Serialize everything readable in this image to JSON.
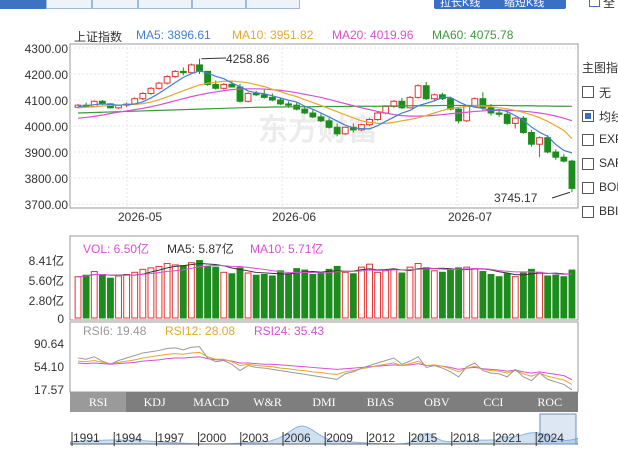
{
  "top_tabs": [
    "",
    "",
    "",
    "",
    "",
    ""
  ],
  "top_buttons": [
    {
      "label": "拉长K线",
      "icon": "stretch-icon"
    },
    {
      "label": "缩短K线",
      "icon": "shrink-icon"
    }
  ],
  "top_right_label": "全",
  "legend": {
    "name": "上证指数",
    "ma5": "MA5: 3896.61",
    "ma10": "MA10: 3951.82",
    "ma20": "MA20: 4019.96",
    "ma60": "MA60: 4075.78",
    "colors": {
      "ma5": "#3f7fd6",
      "ma10": "#e7a72b",
      "ma20": "#d84fd6",
      "ma60": "#3c9a3c"
    }
  },
  "price_axis": [
    "4300.00",
    "4200.00",
    "4100.00",
    "4000.00",
    "3900.00",
    "3800.00",
    "3700.00"
  ],
  "date_axis": [
    "2026-05",
    "2026-06",
    "2026-07"
  ],
  "annotations": {
    "high": "4258.86",
    "low": "3745.17"
  },
  "watermark": "东方财富",
  "right_panel": {
    "title": "主图指标",
    "items": [
      {
        "label": "无",
        "checked": false
      },
      {
        "label": "均线",
        "checked": true
      },
      {
        "label": "EXPMA",
        "checked": false
      },
      {
        "label": "SAR",
        "checked": false
      },
      {
        "label": "BOLL",
        "checked": false
      },
      {
        "label": "BBI",
        "checked": false
      }
    ]
  },
  "volume": {
    "vol": "VOL: 6.50亿",
    "ma5": "MA5: 5.87亿",
    "ma10": "MA10: 5.71亿",
    "axis": [
      "8.41亿",
      "5.60亿",
      "2.80亿",
      "0"
    ],
    "colors": {
      "vol": "#d84fd6",
      "ma5": "#333333",
      "ma10": "#d84fd6"
    }
  },
  "rsi": {
    "rsi6": "RSI6: 19.48",
    "rsi12": "RSI12: 28.08",
    "rsi24": "RSI24: 35.43",
    "axis": [
      "90.64",
      "54.10",
      "17.57"
    ],
    "colors": {
      "rsi6": "#999999",
      "rsi12": "#e7a72b",
      "rsi24": "#d84fd6"
    }
  },
  "indicator_tabs": [
    "RSI",
    "KDJ",
    "MACD",
    "W&R",
    "DMI",
    "BIAS",
    "OBV",
    "CCI",
    "ROC"
  ],
  "indicator_active": "RSI",
  "timeline_years": [
    "1991",
    "1994",
    "1997",
    "2000",
    "2003",
    "2006",
    "2009",
    "2012",
    "2015",
    "2018",
    "2021",
    "2024"
  ],
  "chart_data": {
    "type": "candlestick",
    "title": "上证指数",
    "x_ticks": [
      "2026-05",
      "2026-06",
      "2026-07"
    ],
    "ylim": [
      3700,
      4300
    ],
    "high_label": 4258.86,
    "low_label": 3745.17,
    "ohlc": [
      [
        4072,
        4085,
        4068,
        4080
      ],
      [
        4080,
        4090,
        4070,
        4075
      ],
      [
        4075,
        4098,
        4073,
        4095
      ],
      [
        4095,
        4100,
        4080,
        4085
      ],
      [
        4085,
        4088,
        4068,
        4070
      ],
      [
        4070,
        4082,
        4065,
        4080
      ],
      [
        4080,
        4090,
        4072,
        4084
      ],
      [
        4084,
        4110,
        4080,
        4105
      ],
      [
        4105,
        4130,
        4100,
        4125
      ],
      [
        4125,
        4150,
        4120,
        4145
      ],
      [
        4145,
        4170,
        4140,
        4165
      ],
      [
        4165,
        4195,
        4160,
        4190
      ],
      [
        4190,
        4215,
        4185,
        4210
      ],
      [
        4210,
        4225,
        4195,
        4205
      ],
      [
        4205,
        4240,
        4200,
        4235
      ],
      [
        4235,
        4258.86,
        4200,
        4210
      ],
      [
        4210,
        4212,
        4155,
        4160
      ],
      [
        4160,
        4175,
        4140,
        4145
      ],
      [
        4145,
        4165,
        4140,
        4160
      ],
      [
        4160,
        4172,
        4148,
        4150
      ],
      [
        4150,
        4162,
        4090,
        4095
      ],
      [
        4095,
        4130,
        4090,
        4125
      ],
      [
        4125,
        4135,
        4115,
        4120
      ],
      [
        4120,
        4140,
        4105,
        4110
      ],
      [
        4110,
        4125,
        4095,
        4100
      ],
      [
        4100,
        4108,
        4080,
        4085
      ],
      [
        4085,
        4095,
        4070,
        4080
      ],
      [
        4080,
        4090,
        4060,
        4065
      ],
      [
        4065,
        4078,
        4045,
        4050
      ],
      [
        4050,
        4062,
        4030,
        4035
      ],
      [
        4035,
        4048,
        4015,
        4020
      ],
      [
        4020,
        4030,
        3990,
        3995
      ],
      [
        3995,
        4010,
        3960,
        3970
      ],
      [
        3970,
        3998,
        3965,
        3995
      ],
      [
        3995,
        4010,
        3975,
        3985
      ],
      [
        3985,
        4008,
        3980,
        4005
      ],
      [
        4005,
        4030,
        4000,
        4025
      ],
      [
        4025,
        4055,
        4020,
        4050
      ],
      [
        4050,
        4078,
        4045,
        4075
      ],
      [
        4075,
        4100,
        4070,
        4095
      ],
      [
        4095,
        4108,
        4065,
        4070
      ],
      [
        4070,
        4115,
        4068,
        4110
      ],
      [
        4110,
        4160,
        4105,
        4155
      ],
      [
        4155,
        4170,
        4100,
        4105
      ],
      [
        4105,
        4125,
        4095,
        4120
      ],
      [
        4120,
        4128,
        4100,
        4105
      ],
      [
        4105,
        4112,
        4060,
        4065
      ],
      [
        4065,
        4070,
        4010,
        4020
      ],
      [
        4020,
        4080,
        4015,
        4075
      ],
      [
        4075,
        4110,
        4070,
        4105
      ],
      [
        4105,
        4130,
        4060,
        4070
      ],
      [
        4070,
        4085,
        4040,
        4050
      ],
      [
        4050,
        4062,
        4035,
        4045
      ],
      [
        4045,
        4055,
        4005,
        4010
      ],
      [
        4010,
        4035,
        3990,
        4030
      ],
      [
        4030,
        4038,
        3970,
        3975
      ],
      [
        3975,
        3985,
        3920,
        3930
      ],
      [
        3930,
        3960,
        3880,
        3955
      ],
      [
        3955,
        3965,
        3895,
        3900
      ],
      [
        3900,
        3910,
        3870,
        3880
      ],
      [
        3880,
        3892,
        3860,
        3865
      ],
      [
        3865,
        3870,
        3745.17,
        3760
      ]
    ],
    "ma5": [
      4075,
      4078,
      4082,
      4085,
      4083,
      4080,
      4082,
      4085,
      4093,
      4108,
      4126,
      4146,
      4167,
      4187,
      4201,
      4212,
      4204,
      4191,
      4182,
      4165,
      4152,
      4135,
      4128,
      4124,
      4116,
      4108,
      4099,
      4092,
      4076,
      4064,
      4050,
      4035,
      4019,
      4003,
      3993,
      3990,
      3989,
      4001,
      4018,
      4034,
      4050,
      4060,
      4078,
      4087,
      4097,
      4110,
      4110,
      4093,
      4079,
      4073,
      4067,
      4060,
      4063,
      4056,
      4040,
      4022,
      3996,
      3976,
      3960,
      3929,
      3906,
      3896.61
    ],
    "ma10": [
      4070,
      4072,
      4074,
      4077,
      4079,
      4080,
      4082,
      4083,
      4086,
      4092,
      4101,
      4112,
      4124,
      4136,
      4147,
      4158,
      4165,
      4168,
      4172,
      4173,
      4170,
      4166,
      4159,
      4152,
      4141,
      4132,
      4122,
      4113,
      4101,
      4090,
      4079,
      4067,
      4055,
      4043,
      4031,
      4020,
      4014,
      4010,
      4010,
      4014,
      4020,
      4025,
      4032,
      4040,
      4050,
      4060,
      4068,
      4072,
      4075,
      4078,
      4077,
      4074,
      4070,
      4066,
      4060,
      4052,
      4043,
      4032,
      4018,
      4001,
      3983,
      3951.82
    ],
    "ma20": [
      4030,
      4033,
      4037,
      4042,
      4048,
      4053,
      4058,
      4063,
      4068,
      4074,
      4081,
      4089,
      4097,
      4105,
      4113,
      4120,
      4126,
      4131,
      4136,
      4140,
      4142,
      4143,
      4143,
      4142,
      4140,
      4137,
      4133,
      4128,
      4122,
      4116,
      4110,
      4102,
      4094,
      4086,
      4078,
      4070,
      4063,
      4056,
      4050,
      4044,
      4040,
      4038,
      4038,
      4039,
      4041,
      4044,
      4047,
      4050,
      4053,
      4056,
      4058,
      4060,
      4060,
      4060,
      4059,
      4057,
      4054,
      4050,
      4045,
      4038,
      4030,
      4019.96
    ],
    "ma60": [
      4050,
      4051,
      4052,
      4053,
      4054,
      4055,
      4056,
      4057,
      4058,
      4059,
      4060,
      4061,
      4062,
      4063,
      4064,
      4065,
      4066,
      4067,
      4068,
      4069,
      4070,
      4071,
      4072,
      4072,
      4073,
      4073,
      4074,
      4074,
      4074,
      4074,
      4075,
      4075,
      4075,
      4075,
      4076,
      4076,
      4076,
      4076,
      4077,
      4077,
      4077,
      4078,
      4078,
      4078,
      4078,
      4079,
      4079,
      4079,
      4079,
      4079,
      4079,
      4079,
      4079,
      4079,
      4078,
      4078,
      4078,
      4077,
      4077,
      4076,
      4076,
      4075.78
    ],
    "volume_yi": [
      5.6,
      5.8,
      6.3,
      5.9,
      5.4,
      5.7,
      5.9,
      6.2,
      6.6,
      6.8,
      7.0,
      7.4,
      7.2,
      7.1,
      7.5,
      7.8,
      7.0,
      6.9,
      6.2,
      6.0,
      6.8,
      6.1,
      5.8,
      5.9,
      5.7,
      6.4,
      6.0,
      6.7,
      6.5,
      5.9,
      6.0,
      6.6,
      7.0,
      6.2,
      6.0,
      6.9,
      7.3,
      6.2,
      6.4,
      6.6,
      6.1,
      6.9,
      7.4,
      6.8,
      6.4,
      6.2,
      6.6,
      6.8,
      6.9,
      6.7,
      6.3,
      5.9,
      5.6,
      6.0,
      5.6,
      6.1,
      6.6,
      6.2,
      5.7,
      5.8,
      5.6,
      6.5
    ],
    "volume_up": [
      true,
      false,
      true,
      false,
      false,
      true,
      true,
      true,
      true,
      true,
      true,
      true,
      true,
      false,
      true,
      false,
      false,
      false,
      true,
      false,
      false,
      true,
      false,
      false,
      false,
      false,
      false,
      false,
      false,
      false,
      false,
      false,
      false,
      true,
      false,
      true,
      true,
      true,
      true,
      true,
      false,
      true,
      true,
      false,
      true,
      false,
      false,
      false,
      true,
      true,
      false,
      false,
      false,
      false,
      true,
      false,
      false,
      true,
      false,
      false,
      false,
      false
    ],
    "rsi6": [
      70,
      68,
      72,
      65,
      60,
      66,
      70,
      74,
      78,
      80,
      82,
      85,
      86,
      83,
      87,
      88,
      70,
      64,
      66,
      60,
      50,
      58,
      55,
      54,
      52,
      50,
      48,
      46,
      44,
      42,
      40,
      38,
      36,
      45,
      48,
      54,
      58,
      62,
      66,
      70,
      60,
      65,
      72,
      55,
      58,
      54,
      48,
      40,
      56,
      62,
      50,
      46,
      45,
      40,
      52,
      40,
      34,
      46,
      36,
      32,
      28,
      19.48
    ],
    "rsi12": [
      65,
      64,
      66,
      63,
      61,
      63,
      65,
      67,
      70,
      72,
      74,
      76,
      77,
      76,
      78,
      79,
      72,
      68,
      68,
      64,
      58,
      60,
      58,
      57,
      56,
      54,
      53,
      51,
      50,
      48,
      47,
      45,
      44,
      48,
      50,
      53,
      55,
      58,
      60,
      62,
      58,
      61,
      65,
      58,
      59,
      57,
      53,
      48,
      54,
      57,
      52,
      50,
      49,
      46,
      50,
      45,
      41,
      46,
      41,
      38,
      35,
      28.08
    ],
    "rsi24": [
      62,
      61,
      62,
      61,
      60,
      61,
      62,
      63,
      65,
      66,
      67,
      69,
      70,
      70,
      71,
      72,
      69,
      67,
      67,
      65,
      62,
      62,
      61,
      60,
      60,
      59,
      58,
      57,
      56,
      55,
      54,
      53,
      52,
      53,
      54,
      55,
      56,
      57,
      58,
      59,
      58,
      59,
      61,
      58,
      58,
      57,
      55,
      52,
      54,
      55,
      53,
      52,
      51,
      49,
      51,
      48,
      46,
      48,
      46,
      44,
      42,
      35.43
    ]
  }
}
